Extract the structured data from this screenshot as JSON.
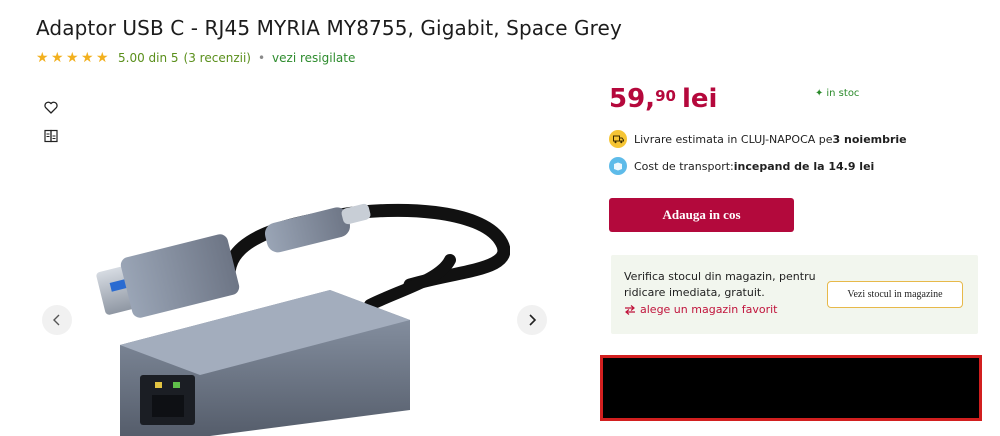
{
  "product": {
    "title": "Adaptor USB C - RJ45 MYRIA MY8755, Gigabit, Space Grey",
    "rating_value": "5.00 din 5",
    "rating_count": "(3 recenzii)",
    "separator": "•",
    "resigilate_link": "vezi resigilate",
    "stars": [
      "★",
      "★",
      "★",
      "★",
      "★"
    ]
  },
  "icons": {
    "wishlist": "heart-icon",
    "compare": "compare-icon",
    "prev": "chevron-left-icon",
    "next": "chevron-right-icon",
    "delivery": "truck-icon",
    "shipping": "box-icon",
    "swap": "swap-arrows-icon"
  },
  "price": {
    "integer": "59,",
    "decimals": "90",
    "currency": "lei",
    "color": "#b5083c"
  },
  "stock": {
    "mark": "✦",
    "label": "in stoc",
    "color": "#2a8a2a"
  },
  "delivery": {
    "prefix": "Livrare estimata in CLUJ-NAPOCA pe ",
    "date": "3 noiembrie"
  },
  "shipping": {
    "prefix": "Cost de transport: ",
    "value": "incepand de la 14.9 lei"
  },
  "cart": {
    "button_label": "Adauga in cos",
    "color": "#b3093c"
  },
  "store": {
    "text": "Verifica stocul din magazin, pentru ridicare imediata, gratuit.",
    "link_label": "alege un magazin favorit",
    "button_label": "Vezi stocul in magazine"
  }
}
